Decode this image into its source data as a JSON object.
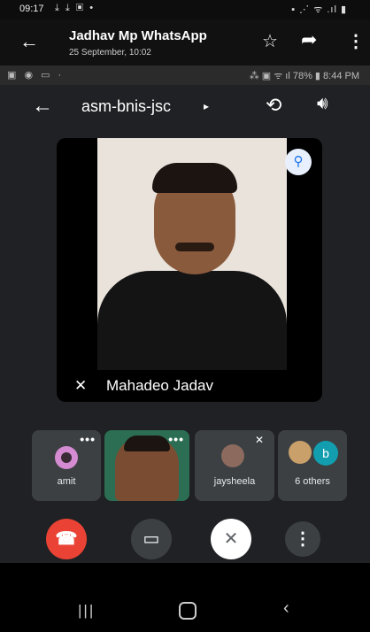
{
  "outer_status": {
    "time": "09:17",
    "left_icons": "⤓ ⤓ ▣ •",
    "right_icons": "▪ ⋰ ᯤ .ıl ▮"
  },
  "whatsapp_header": {
    "title": "Jadhav Mp WhatsApp",
    "subtitle": "25 September, 10:02"
  },
  "inner_status": {
    "left_icons": "▣ ◉ ▭ ·",
    "right_text": "⁂ ▣ ᯤ ıl 78% ▮ 8:44 PM"
  },
  "meet": {
    "meeting_code": "asm-bnis-jsc",
    "main_participant": "Mahadeo Jadav"
  },
  "participants": [
    {
      "name": "amit"
    },
    {
      "name": ""
    },
    {
      "name": "jaysheela"
    },
    {
      "name": "6 others",
      "avatar_letter": "b"
    }
  ],
  "colors": {
    "end_call": "#ea4335",
    "meet_background": "#202124",
    "tile_background": "#3c4043",
    "pin_accent": "#1a73e8"
  }
}
